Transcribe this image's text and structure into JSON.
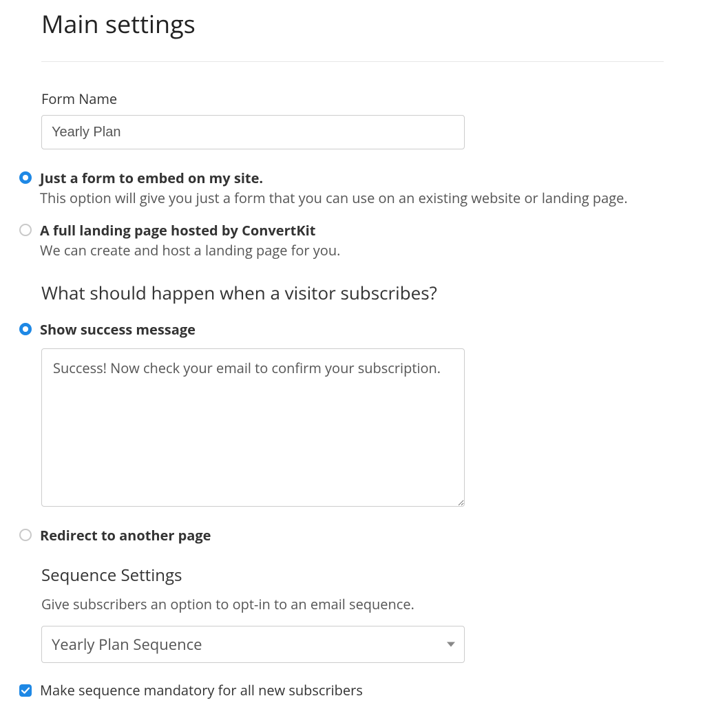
{
  "title": "Main settings",
  "formName": {
    "label": "Form Name",
    "value": "Yearly Plan"
  },
  "formType": {
    "selected": 0,
    "options": [
      {
        "title": "Just a form to embed on my site.",
        "desc": "This option will give you just a form that you can use on an existing website or landing page."
      },
      {
        "title": "A full landing page hosted by ConvertKit",
        "desc": "We can create and host a landing page for you."
      }
    ]
  },
  "onSubscribe": {
    "heading": "What should happen when a visitor subscribes?",
    "selected": 0,
    "options": [
      {
        "title": "Show success message"
      },
      {
        "title": "Redirect to another page"
      }
    ],
    "successMessage": "Success! Now check your email to confirm your subscription."
  },
  "sequence": {
    "heading": "Sequence Settings",
    "desc": "Give subscribers an option to opt-in to an email sequence.",
    "selected": "Yearly Plan Sequence",
    "mandatoryLabel": "Make sequence mandatory for all new subscribers",
    "mandatoryChecked": true
  }
}
